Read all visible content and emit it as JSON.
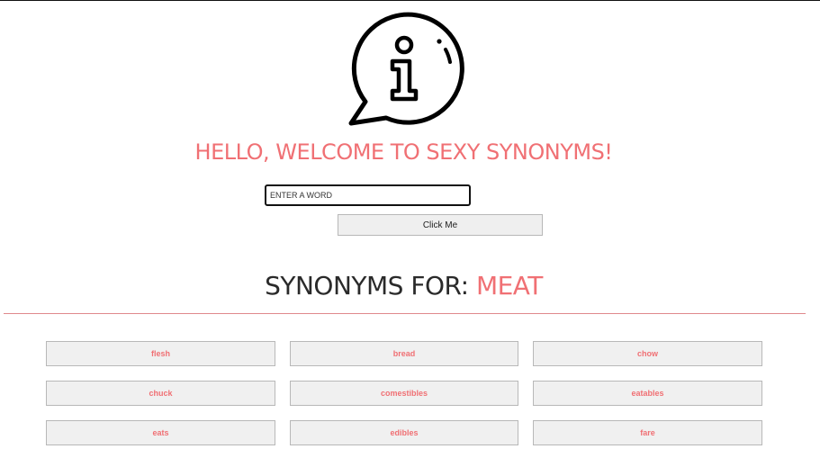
{
  "header": {
    "logo_icon": "info-speech-bubble-icon",
    "welcome_text": "HELLO, WELCOME TO SEXY SYNONYMS!"
  },
  "search": {
    "placeholder": "ENTER A WORD",
    "value": "",
    "button_label": "Click Me"
  },
  "results": {
    "heading_prefix": "SYNONYMS FOR: ",
    "heading_word": "MEAT",
    "synonyms": [
      "flesh",
      "bread",
      "chow",
      "chuck",
      "comestibles",
      "eatables",
      "eats",
      "edibles",
      "fare"
    ]
  },
  "colors": {
    "accent": "#f07074",
    "button_bg": "#f0f0f0",
    "text_dark": "#2a2a2a"
  }
}
